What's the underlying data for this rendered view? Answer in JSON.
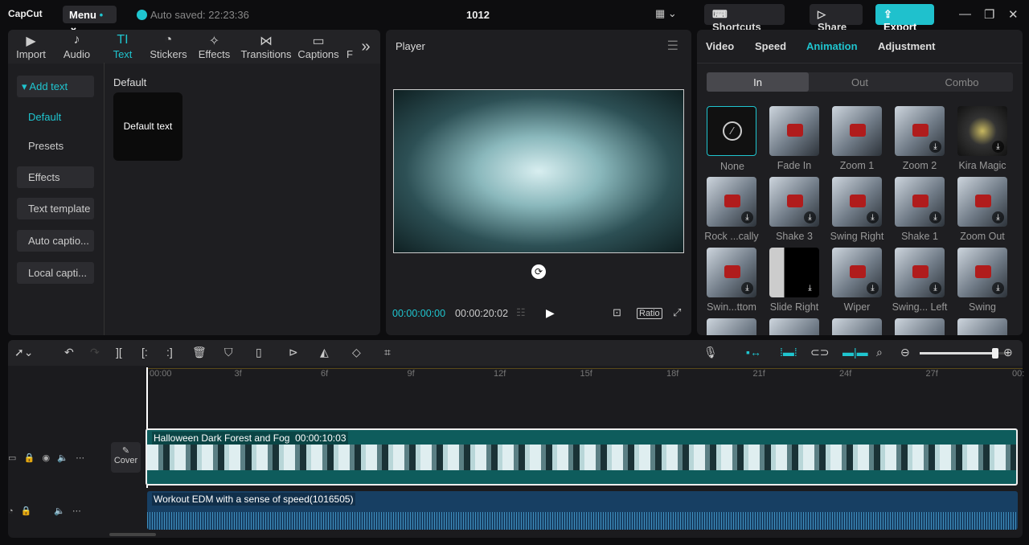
{
  "titlebar": {
    "logo": "CapCut",
    "menu": "Menu",
    "autosaved": "Auto saved: 22:23:36",
    "project": "1012",
    "shortcuts": "Shortcuts",
    "share": "Share",
    "export": "Export"
  },
  "toolbar_tabs": [
    {
      "label": "Import",
      "icon": "▶"
    },
    {
      "label": "Audio",
      "icon": "♪"
    },
    {
      "label": "Text",
      "icon": "TI"
    },
    {
      "label": "Stickers",
      "icon": "◔"
    },
    {
      "label": "Effects",
      "icon": "✧"
    },
    {
      "label": "Transitions",
      "icon": "⋈"
    },
    {
      "label": "Captions",
      "icon": "▭"
    },
    {
      "label": "F",
      "icon": ""
    }
  ],
  "sidebar": {
    "add_text": "Add text",
    "items": [
      "Default",
      "Presets",
      "Effects",
      "Text template",
      "Auto captio...",
      "Local capti..."
    ]
  },
  "content": {
    "section": "Default",
    "card": "Default text"
  },
  "player": {
    "title": "Player",
    "current": "00:00:00:00",
    "total": "00:00:20:02",
    "ratio": "Ratio"
  },
  "right_panel": {
    "tabs": [
      "Video",
      "Speed",
      "Animation",
      "Adjustment"
    ],
    "active_tab": "Animation",
    "segments": [
      "In",
      "Out",
      "Combo"
    ],
    "animations": [
      {
        "label": "None",
        "dl": false
      },
      {
        "label": "Fade In",
        "dl": false
      },
      {
        "label": "Zoom 1",
        "dl": false
      },
      {
        "label": "Zoom 2",
        "dl": true
      },
      {
        "label": "Kira Magic",
        "dl": true
      },
      {
        "label": "Rock ...cally",
        "dl": true
      },
      {
        "label": "Shake 3",
        "dl": true
      },
      {
        "label": "Swing Right",
        "dl": true
      },
      {
        "label": "Shake 1",
        "dl": true
      },
      {
        "label": "Zoom Out",
        "dl": true
      },
      {
        "label": "Swin...ttom",
        "dl": true
      },
      {
        "label": "Slide Right",
        "dl": true
      },
      {
        "label": "Wiper",
        "dl": true
      },
      {
        "label": "Swing... Left",
        "dl": true
      },
      {
        "label": "Swing",
        "dl": true
      }
    ]
  },
  "timeline": {
    "ruler": [
      "00:00",
      "3f",
      "6f",
      "9f",
      "12f",
      "15f",
      "18f",
      "21f",
      "24f",
      "27f",
      "00:"
    ],
    "cover": "Cover",
    "video_clip": {
      "name": "Halloween Dark Forest and Fog",
      "duration": "00:00:10:03"
    },
    "audio_clip": {
      "name": "Workout EDM with a sense of speed(1016505)"
    },
    "zoom_level": 0.85
  },
  "colors": {
    "accent": "#1fc5cf"
  }
}
